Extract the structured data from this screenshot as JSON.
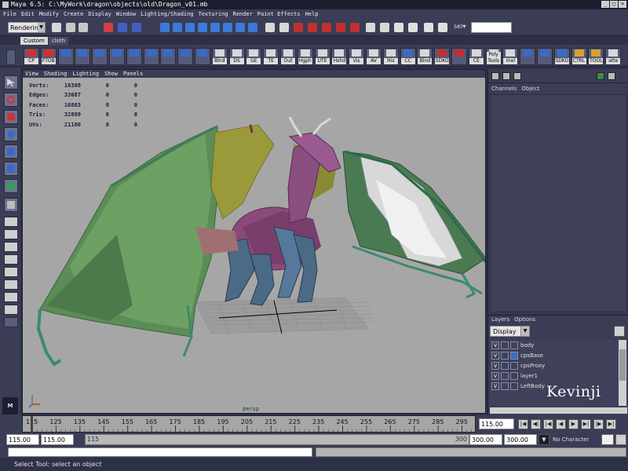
{
  "window": {
    "title": "Maya 6.5: C:\\MyWork\\dragon\\objects\\old\\Dragon_v01.mb"
  },
  "menus": [
    "File",
    "Edit",
    "Modify",
    "Create",
    "Display",
    "Window",
    "Lighting/Shading",
    "Texturing",
    "Render",
    "Paint Effects",
    "Help"
  ],
  "status_line": {
    "menu_set": "Rendering",
    "selection_label": "sel▾",
    "selection_field": ""
  },
  "shelf": {
    "tabs": [
      "Custom",
      "cloth"
    ],
    "active_tab": "Custom",
    "buttons": [
      {
        "label": "CP",
        "icon": "red-arrow-icon"
      },
      {
        "label": "FTOB",
        "icon": "red-arrow-icon"
      },
      {
        "label": "",
        "icon": "cube-icon"
      },
      {
        "label": "",
        "icon": "cube-icon"
      },
      {
        "label": "",
        "icon": "cube-icon"
      },
      {
        "label": "",
        "icon": "cube-icon"
      },
      {
        "label": "",
        "icon": "cube-icon"
      },
      {
        "label": "",
        "icon": "cube-icon"
      },
      {
        "label": "",
        "icon": "cube-icon"
      },
      {
        "label": "",
        "icon": "cube-icon"
      },
      {
        "label": "",
        "icon": "sphere-icon"
      },
      {
        "label": "Blnd",
        "icon": "blank-icon"
      },
      {
        "label": "DS",
        "icon": "blank-icon"
      },
      {
        "label": "GE",
        "icon": "blank-icon"
      },
      {
        "label": "TE",
        "icon": "blank-icon"
      },
      {
        "label": "Out",
        "icon": "blank-icon"
      },
      {
        "label": "Hgph",
        "icon": "blank-icon"
      },
      {
        "label": "UTE",
        "icon": "blank-icon"
      },
      {
        "label": "Hshd",
        "icon": "blank-icon"
      },
      {
        "label": "Vis",
        "icon": "blank-icon"
      },
      {
        "label": "AV",
        "icon": "blank-icon"
      },
      {
        "label": "His",
        "icon": "brush-icon"
      },
      {
        "label": "CC",
        "icon": "cube-icon"
      },
      {
        "label": "Blnd",
        "icon": "blank-icon"
      },
      {
        "label": "SDKO",
        "icon": "grid-icon"
      },
      {
        "label": "",
        "icon": "grid-icon"
      },
      {
        "label": "CE",
        "icon": "blank-icon"
      },
      {
        "label": "Poly Tools",
        "icon": "blank-icon"
      },
      {
        "label": "mel",
        "icon": "blank-icon"
      },
      {
        "label": "",
        "icon": "cube-icon"
      },
      {
        "label": "",
        "icon": "cube-icon"
      },
      {
        "label": "SDKO",
        "icon": "cube-icon"
      },
      {
        "label": "CTRL",
        "icon": "gear-icon"
      },
      {
        "label": "TOOL",
        "icon": "gear-icon"
      },
      {
        "label": "atte",
        "icon": "brush-icon"
      }
    ]
  },
  "viewport": {
    "menu": [
      "View",
      "Shading",
      "Lighting",
      "Show",
      "Panels"
    ],
    "hud": [
      {
        "label": "Verts:",
        "v1": "16308",
        "v2": "0",
        "v3": "0"
      },
      {
        "label": "Edges:",
        "v1": "33087",
        "v2": "0",
        "v3": "0"
      },
      {
        "label": "Faces:",
        "v1": "16803",
        "v2": "0",
        "v3": "0"
      },
      {
        "label": "Tris:",
        "v1": "32809",
        "v2": "0",
        "v3": "0"
      },
      {
        "label": "UVs:",
        "v1": "21100",
        "v2": "0",
        "v3": "0"
      }
    ],
    "camera": "persp"
  },
  "channel_box": {
    "tabs": [
      "Channels",
      "Object"
    ]
  },
  "layer_editor": {
    "tabs": [
      "Layers",
      "Options"
    ],
    "display_mode": "Display",
    "layers": [
      {
        "visible": "V",
        "name": "body",
        "color": ""
      },
      {
        "visible": "V",
        "name": "cpsBase",
        "color": "#3a6bc8"
      },
      {
        "visible": "V",
        "name": "cpsProxy",
        "color": ""
      },
      {
        "visible": "V",
        "name": "layer1",
        "color": ""
      },
      {
        "visible": "V",
        "name": "LeftBody",
        "color": ""
      }
    ]
  },
  "watermark": "Kevinji",
  "time_slider": {
    "ticks": [
      "115",
      "125",
      "135",
      "145",
      "155",
      "165",
      "175",
      "185",
      "195",
      "205",
      "215",
      "225",
      "235",
      "245",
      "255",
      "265",
      "275",
      "285",
      "295"
    ],
    "current_time": "115.00"
  },
  "range_slider": {
    "start_time": "115.00",
    "playback_start": "115.00",
    "range_start": "115",
    "range_end": "300",
    "playback_end": "300.00",
    "end_time": "300.00",
    "character_set": "No Character Set"
  },
  "help_line": "Select Tool: select an object"
}
